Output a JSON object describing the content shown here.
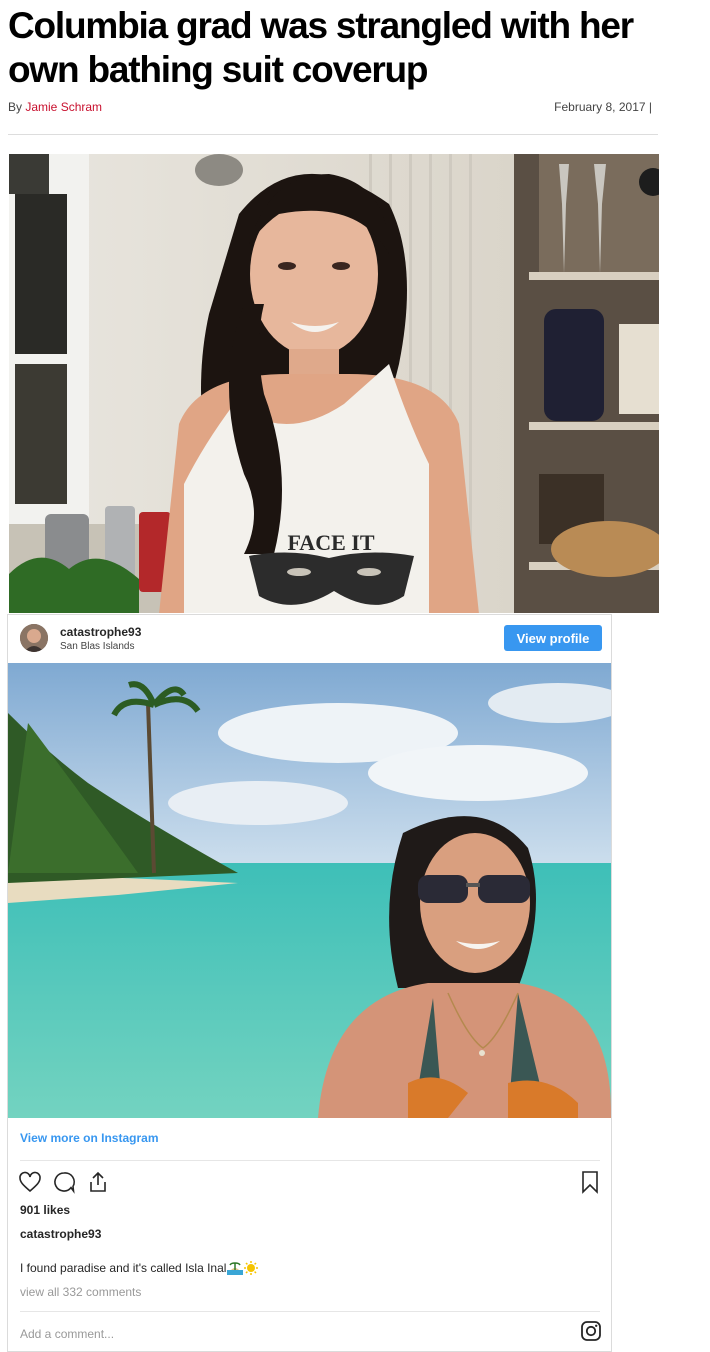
{
  "article": {
    "headline": "Columbia grad was strangled with her own bathing suit coverup",
    "byline_prefix": "By ",
    "author": "Jamie Schram",
    "date": "February 8, 2017 |"
  },
  "photo1": {
    "shirt_text": "FACE IT"
  },
  "instagram": {
    "username": "catastrophe93",
    "location": "San Blas Islands",
    "view_profile_label": "View profile",
    "view_more_label": "View more on Instagram",
    "likes": "901 likes",
    "caption_user": "catastrophe93",
    "caption": "I found paradise and it's called Isla Inal",
    "comments_link": "view all 332 comments",
    "comment_placeholder": "Add a comment...",
    "icons": [
      "heart-icon",
      "comment-icon",
      "share-icon",
      "bookmark-icon",
      "instagram-icon"
    ]
  },
  "colors": {
    "author_link": "#c8102e",
    "instagram_blue": "#3897f0"
  }
}
